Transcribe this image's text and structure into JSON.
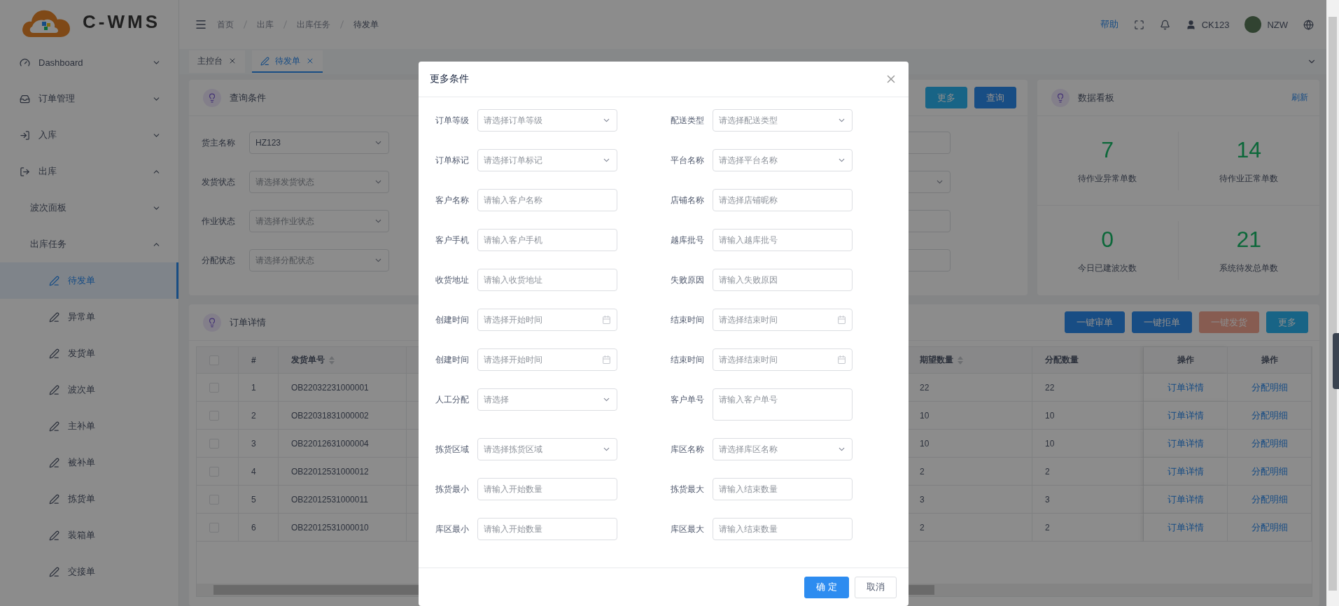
{
  "logo": {
    "text": "C-WMS"
  },
  "sidebar": {
    "items": [
      {
        "label": "Dashboard",
        "expanded": false
      },
      {
        "label": "订单管理",
        "expanded": false
      },
      {
        "label": "入库",
        "expanded": false
      },
      {
        "label": "出库",
        "expanded": true,
        "children": [
          {
            "label": "波次面板",
            "expanded": false
          },
          {
            "label": "出库任务",
            "expanded": true,
            "children": [
              {
                "label": "待发单",
                "selected": true
              },
              {
                "label": "异常单",
                "selected": false
              },
              {
                "label": "发货单",
                "selected": false
              },
              {
                "label": "波次单",
                "selected": false
              },
              {
                "label": "主补单",
                "selected": false
              },
              {
                "label": "被补单",
                "selected": false
              },
              {
                "label": "拣货单",
                "selected": false
              },
              {
                "label": "装箱单",
                "selected": false
              },
              {
                "label": "交接单",
                "selected": false
              }
            ]
          }
        ]
      }
    ]
  },
  "header": {
    "breadcrumb": [
      "首页",
      "出库",
      "出库任务",
      "待发单"
    ],
    "help": "帮助",
    "user": "CK123",
    "account": "NZW"
  },
  "tabs": [
    {
      "label": "主控台",
      "selected": false
    },
    {
      "label": "待发单",
      "selected": true
    }
  ],
  "query": {
    "title": "查询条件",
    "buttons": [
      {
        "label": "更多",
        "kind": "info"
      },
      {
        "label": "查询",
        "kind": "primary"
      }
    ],
    "fields": [
      {
        "label": "货主名称",
        "kind": "select",
        "value": "HZ123"
      },
      {
        "label": "发货状态",
        "kind": "select",
        "placeholder": "请选择发货状态"
      },
      {
        "label": "作业状态",
        "kind": "select",
        "placeholder": "请选择作业状态"
      },
      {
        "label": "分配状态",
        "kind": "select",
        "placeholder": "请选择分配状态"
      }
    ],
    "hidden_fields": [
      {
        "kind": "input"
      },
      {
        "kind": "select"
      },
      {
        "kind": "input"
      },
      {
        "kind": "input"
      }
    ]
  },
  "dashboard": {
    "title": "数据看板",
    "refresh": "刷新",
    "stats": [
      {
        "value": "7",
        "label": "待作业异常单数"
      },
      {
        "value": "14",
        "label": "待作业正常单数"
      },
      {
        "value": "0",
        "label": "今日已建波次数"
      },
      {
        "value": "21",
        "label": "系统待发总单数"
      }
    ]
  },
  "orders": {
    "title": "订单详情",
    "buttons": [
      {
        "label": "一键审单",
        "kind": "primary",
        "disabled": false
      },
      {
        "label": "一键拒单",
        "kind": "primary",
        "disabled": false
      },
      {
        "label": "一键发货",
        "kind": "danger",
        "disabled": true
      },
      {
        "label": "更多",
        "kind": "info",
        "disabled": false
      }
    ],
    "table": {
      "all_checked": false,
      "columns": [
        {
          "kind": "text",
          "label": "#",
          "sortable": false
        },
        {
          "kind": "text",
          "label": "发货单号",
          "sortable": true
        },
        {
          "kind": "hidden"
        },
        {
          "kind": "text",
          "label": "期望数量",
          "sortable": true
        },
        {
          "kind": "text",
          "label": "分配数量",
          "sortable": false
        },
        {
          "kind": "action",
          "label": "操作",
          "sortable": false
        },
        {
          "kind": "action",
          "label": "操作",
          "sortable": false
        }
      ],
      "rows": [
        {
          "checked": false,
          "cells": [
            "1",
            "OB22032231000001",
            null,
            "22",
            "22",
            "订单详情",
            "分配明细"
          ]
        },
        {
          "checked": false,
          "cells": [
            "2",
            "OB22031831000002",
            null,
            "10",
            "10",
            "订单详情",
            "分配明细"
          ]
        },
        {
          "checked": false,
          "cells": [
            "3",
            "OB22012631000004",
            null,
            "10",
            "10",
            "订单详情",
            "分配明细"
          ]
        },
        {
          "checked": false,
          "cells": [
            "4",
            "OB22012531000012",
            null,
            "2",
            "2",
            "订单详情",
            "分配明细"
          ]
        },
        {
          "checked": false,
          "cells": [
            "5",
            "OB22012531000011",
            null,
            "3",
            "3",
            "订单详情",
            "分配明细"
          ]
        },
        {
          "checked": false,
          "cells": [
            "6",
            "OB22012531000010",
            null,
            "2",
            "2",
            "订单详情",
            "分配明细"
          ]
        }
      ]
    }
  },
  "modal": {
    "title": "更多条件",
    "fields": [
      {
        "label": "订单等级",
        "kind": "select",
        "placeholder": "请选择订单等级"
      },
      {
        "label": "配送类型",
        "kind": "select",
        "placeholder": "请选择配送类型"
      },
      {
        "label": "订单标记",
        "kind": "select",
        "placeholder": "请选择订单标记"
      },
      {
        "label": "平台名称",
        "kind": "select",
        "placeholder": "请选择平台名称"
      },
      {
        "label": "客户名称",
        "kind": "input",
        "placeholder": "请输入客户名称"
      },
      {
        "label": "店铺名称",
        "kind": "input",
        "placeholder": "请选择店铺昵称"
      },
      {
        "label": "客户手机",
        "kind": "input",
        "placeholder": "请输入客户手机"
      },
      {
        "label": "越库批号",
        "kind": "input",
        "placeholder": "请输入越库批号"
      },
      {
        "label": "收货地址",
        "kind": "input",
        "placeholder": "请输入收货地址"
      },
      {
        "label": "失败原因",
        "kind": "input",
        "placeholder": "请输入失败原因"
      },
      {
        "label": "创建时间",
        "kind": "date",
        "placeholder": "请选择开始时间"
      },
      {
        "label": "结束时间",
        "kind": "date",
        "placeholder": "请选择结束时间"
      },
      {
        "label": "创建时间",
        "kind": "date",
        "placeholder": "请选择开始时间"
      },
      {
        "label": "结束时间",
        "kind": "date",
        "placeholder": "请选择结束时间"
      },
      {
        "label": "人工分配",
        "kind": "select",
        "placeholder": "请选择"
      },
      {
        "label": "客户单号",
        "kind": "textarea",
        "placeholder": "请输入客户单号"
      },
      {
        "label": "拣货区域",
        "kind": "select",
        "placeholder": "请选择拣货区域"
      },
      {
        "label": "库区名称",
        "kind": "select",
        "placeholder": "请选择库区名称"
      },
      {
        "label": "拣货最小",
        "kind": "input",
        "placeholder": "请输入开始数量"
      },
      {
        "label": "拣货最大",
        "kind": "input",
        "placeholder": "请输入结束数量"
      },
      {
        "label": "库区最小",
        "kind": "input",
        "placeholder": "请输入开始数量"
      },
      {
        "label": "库区最大",
        "kind": "input",
        "placeholder": "请输入结束数量"
      }
    ],
    "buttons": [
      {
        "label": "确 定",
        "kind": "primary"
      },
      {
        "label": "取消",
        "kind": "default"
      }
    ]
  }
}
